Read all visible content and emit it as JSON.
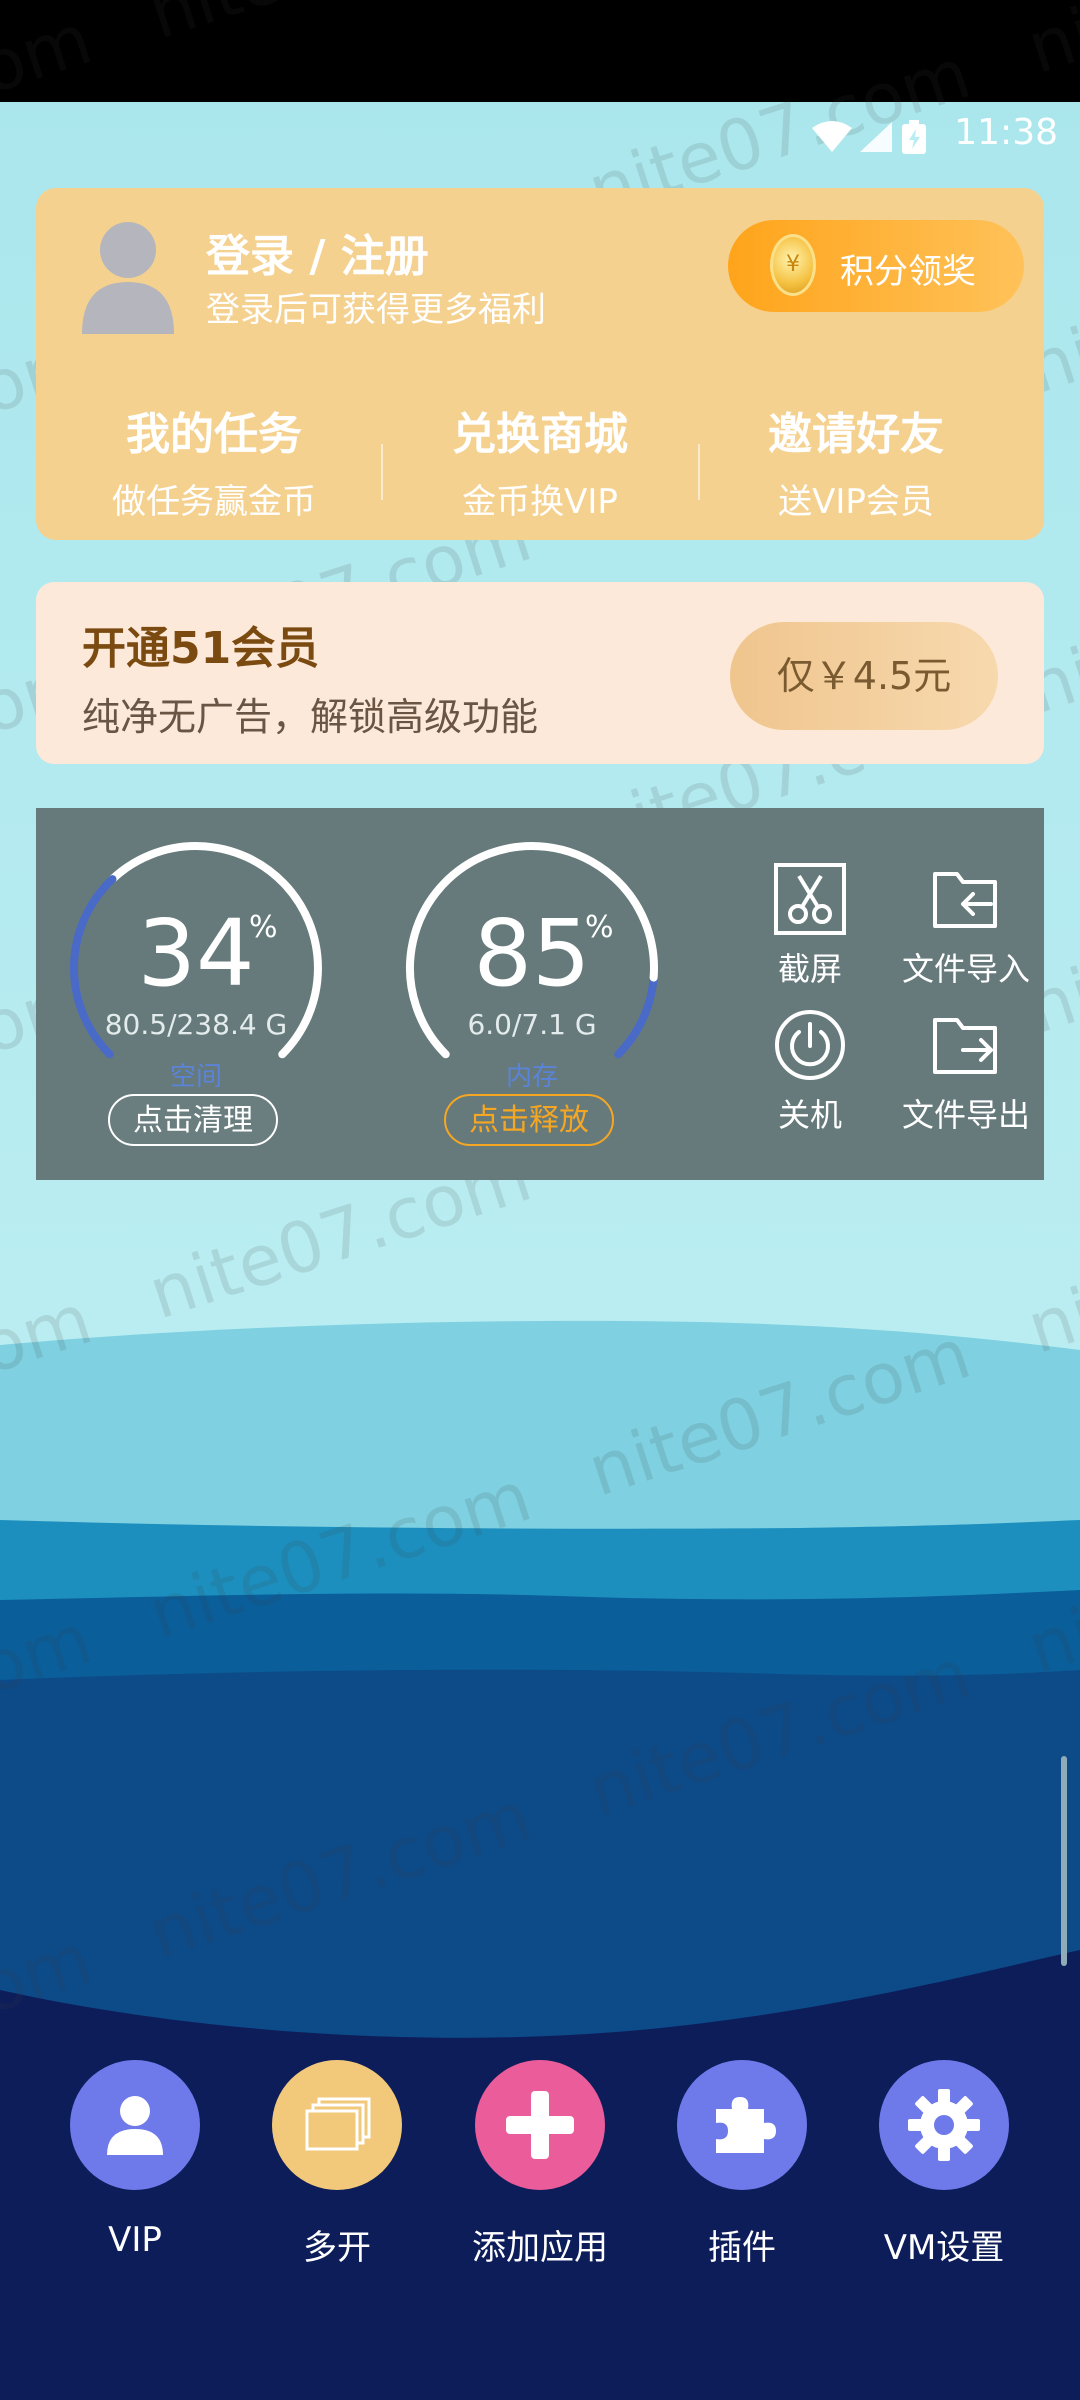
{
  "status_bar": {
    "time": "11:38"
  },
  "user_card": {
    "login_title": "登录 / 注册",
    "login_subtitle": "登录后可获得更多福利",
    "points_button": {
      "coin_symbol": "¥",
      "label": "积分领奖"
    },
    "menu": [
      {
        "title": "我的任务",
        "subtitle": "做任务赢金币"
      },
      {
        "title": "兑换商城",
        "subtitle": "金币换VIP"
      },
      {
        "title": "邀请好友",
        "subtitle": "送VIP会员"
      }
    ]
  },
  "vip_banner": {
    "title": "开通51会员",
    "subtitle": "纯净无广告，解锁高级功能",
    "price_button": "仅￥4.5元"
  },
  "storage_gauge": {
    "percent": "34",
    "percent_sign": "%",
    "detail": "80.5/238.4 G",
    "label": "空间",
    "action": "点击清理",
    "fill_fraction": 0.34
  },
  "memory_gauge": {
    "percent": "85",
    "percent_sign": "%",
    "detail": "6.0/7.1 G",
    "label": "内存",
    "action": "点击释放",
    "fill_fraction": 0.85
  },
  "tools": {
    "screenshot": "截屏",
    "file_import": "文件导入",
    "shutdown": "关机",
    "file_export": "文件导出"
  },
  "watermark_text": "nite07.com",
  "bottom_nav": [
    {
      "label": "VIP",
      "icon": "person-icon",
      "color": "#6e79ea"
    },
    {
      "label": "多开",
      "icon": "stacked-windows-icon",
      "color": "#f2c97a"
    },
    {
      "label": "添加应用",
      "icon": "plus-icon",
      "color": "#ea5c9a"
    },
    {
      "label": "插件",
      "icon": "puzzle-icon",
      "color": "#6e79ea"
    },
    {
      "label": "VM设置",
      "icon": "gear-icon",
      "color": "#6e79ea"
    }
  ],
  "colors": {
    "card_gold": "#f5d190",
    "vip_card": "#fce9d9",
    "tools_panel": "#667a7b",
    "gauge_blue": "#4a6ac8",
    "release_orange": "#f5a623"
  }
}
